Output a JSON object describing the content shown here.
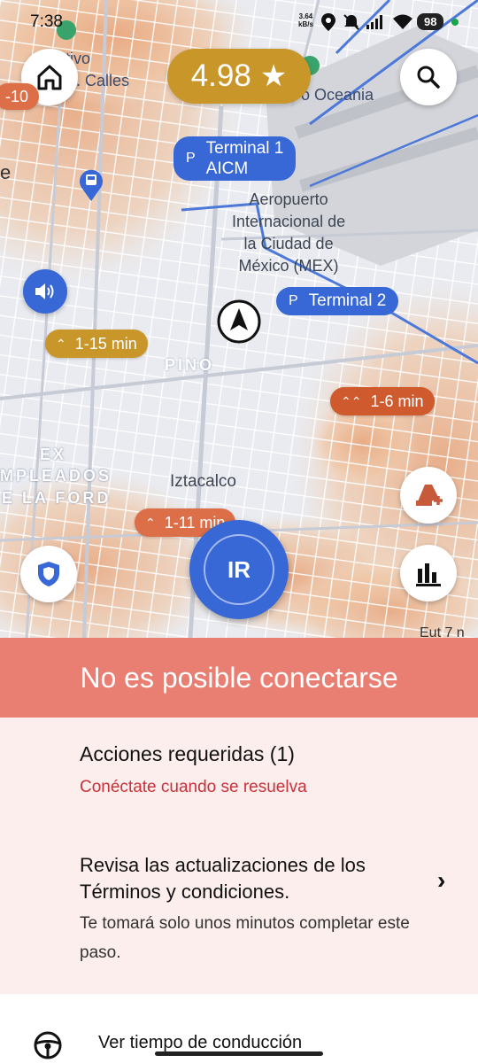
{
  "status_bar": {
    "time": "7:38",
    "net_rate": "3.64",
    "net_unit": "kB/s",
    "battery": "98"
  },
  "map": {
    "labels": [
      {
        "id": "deportivo",
        "text": "rtivo"
      },
      {
        "id": "calles",
        "text": ". Calles"
      },
      {
        "id": "oceania",
        "text": "o Oceania"
      },
      {
        "id": "airport",
        "text": "Aeropuerto\nInternacional de\nla Ciudad de\nMéxico (MEX)"
      },
      {
        "id": "pino",
        "text": "PINO"
      },
      {
        "id": "ex",
        "text": "EX"
      },
      {
        "id": "empleados",
        "text": "MPLEADOS"
      },
      {
        "id": "ford",
        "text": "E LA FORD"
      },
      {
        "id": "iztacalco",
        "text": "Iztacalco"
      },
      {
        "id": "e_edge",
        "text": "e"
      },
      {
        "id": "eut",
        "text": "Eut 7 n"
      }
    ],
    "terminals": [
      {
        "id": "terminal-1",
        "letter": "P",
        "label": "Terminal 1\nAICM"
      },
      {
        "id": "terminal-2",
        "letter": "P",
        "label": "Terminal 2"
      }
    ],
    "surge_pills": [
      {
        "id": "pill-1-15",
        "text": "1-15 min",
        "color": "#c9962a"
      },
      {
        "id": "pill-1-6",
        "text": "1-6 min",
        "color": "#cf5a2d"
      },
      {
        "id": "pill-1-11",
        "text": "1-11 min",
        "color": "#dc6f48"
      },
      {
        "id": "pill-10",
        "text": "-10",
        "color": "#dc6f48"
      }
    ]
  },
  "rating": {
    "value": "4.98"
  },
  "go_button": {
    "label": "IR"
  },
  "banner": {
    "text": "No es posible conectarse"
  },
  "actions": {
    "title": "Acciones requeridas (1)",
    "subtitle": "Conéctate cuando se resuelva",
    "item": {
      "heading": "Revisa las actualizaciones de los Términos y condiciones.",
      "description": "Te tomará solo unos minutos completar este paso."
    }
  },
  "bottom": {
    "driving_time": "Ver tiempo de conducción"
  },
  "colors": {
    "accent": "#3867d6",
    "gold": "#c9962a",
    "banner": "#e97f72",
    "error_text": "#c8323b"
  }
}
